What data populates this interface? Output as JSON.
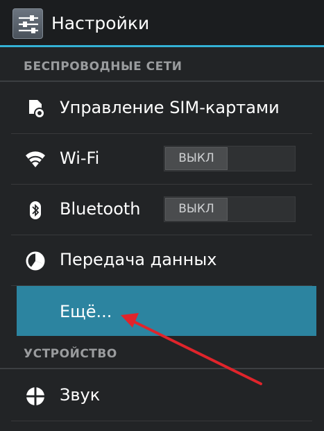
{
  "action_bar": {
    "title": "Настройки",
    "icon": "settings-sliders-icon",
    "accent_color": "#34b2d6"
  },
  "sections": {
    "wireless": {
      "header": "БЕСПРОВОДНЫЕ СЕТИ",
      "items": [
        {
          "label": "Управление SIM-картами",
          "icon": "sim-card-icon"
        },
        {
          "label": "Wi-Fi",
          "icon": "wifi-icon",
          "toggle": "ВЫКЛ"
        },
        {
          "label": "Bluetooth",
          "icon": "bluetooth-icon",
          "toggle": "ВЫКЛ"
        },
        {
          "label": "Передача данных",
          "icon": "data-usage-icon"
        },
        {
          "label": "Ещё...",
          "selected": true,
          "highlight_color": "#2c84a0"
        }
      ]
    },
    "device": {
      "header": "УСТРОЙСТВО",
      "items": [
        {
          "label": "Звук",
          "icon": "sound-icon"
        }
      ]
    }
  },
  "annotation": {
    "type": "arrow",
    "color": "#e0242b",
    "target": "Ещё..."
  }
}
